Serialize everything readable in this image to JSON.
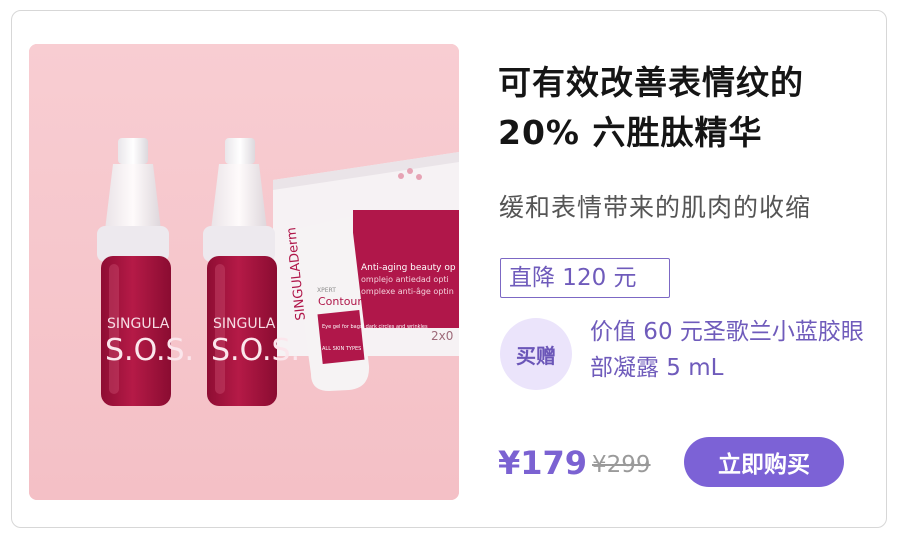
{
  "product": {
    "title": "可有效改善表情纹的 20% 六胜肽精华",
    "subtitle": "缓和表情带来的肌肉的收缩",
    "discount_label": "直降 120 元",
    "gift": {
      "badge": "买赠",
      "text": "价值 60 元圣歌兰小蓝胶眼部凝露 5 mL"
    },
    "price": "¥179",
    "original_price": "¥299",
    "buy_button": "立即购买"
  },
  "photo": {
    "vial_brand": "SINGULA",
    "vial_label": "S.O.S.",
    "tube_brand": "SINGULADerm",
    "tube_line": "XPERT",
    "tube_product": "Contour",
    "tube_desc": "Eye gel for bags, dark circles and wrinkles",
    "tube_skin": "ALL SKIN TYPES",
    "box_line1": "Anti-aging beauty op",
    "box_line2": "omplejo antiedad opti",
    "box_line3": "omplexe anti-âge optin",
    "box_size": "2x0",
    "colors": {
      "background": "#f7c8cd",
      "vial": "#a8123f",
      "box_accent": "#b0174a"
    }
  }
}
